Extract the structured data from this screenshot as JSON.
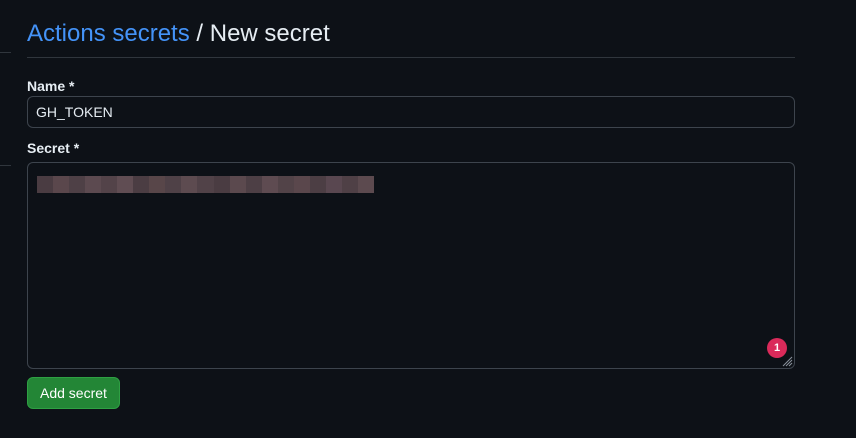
{
  "header": {
    "breadcrumb_link": "Actions secrets",
    "separator": "/",
    "current_page": "New secret"
  },
  "form": {
    "name_label": "Name *",
    "name_value": "GH_TOKEN",
    "secret_label": "Secret *",
    "secret_value_redacted": true,
    "notification_badge_count": "1",
    "submit_label": "Add secret"
  },
  "colors": {
    "background": "#0d1117",
    "link": "#4493f8",
    "primary_button": "#238636",
    "badge": "#da2a5a",
    "border": "#3d444d"
  }
}
